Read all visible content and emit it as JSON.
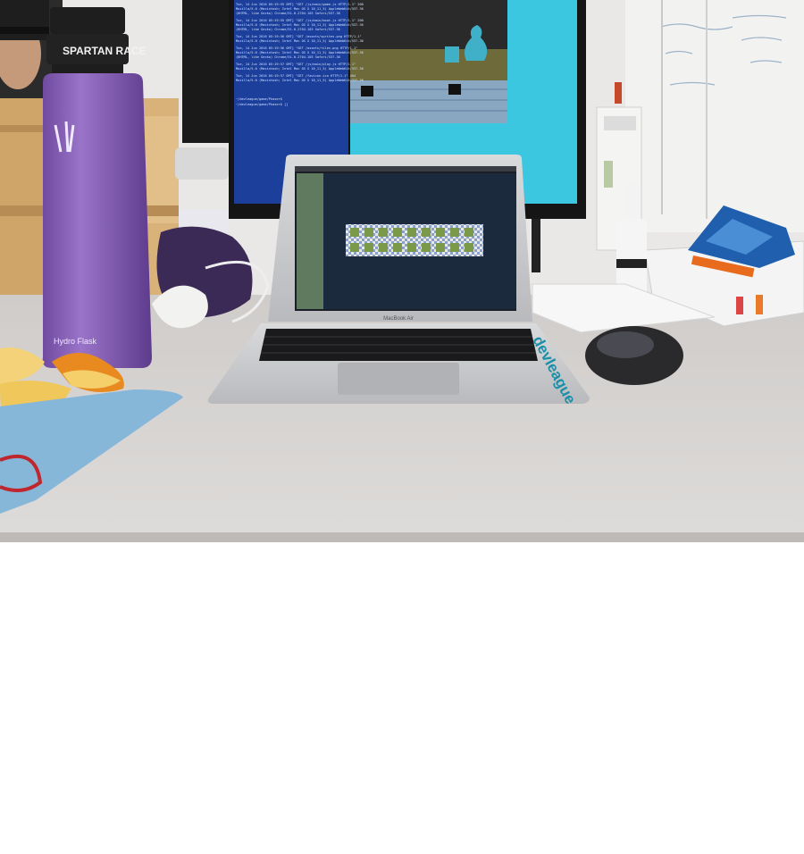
{
  "photo": {
    "bottle_brand_band": "SPARTAN RACE",
    "bottle_maker": "Hydro Flask",
    "laptop_model": "MacBook Air",
    "laptop_sticker": "devleague",
    "terminal_lines": [
      "Tue, 14 Jun 2016 05:19:55 GMT] \"GET /js/main/game.js HTTP/1.1\" 200",
      "Mozilla/5.0 (Macintosh; Intel Mac OS X 10_11_5) AppleWebKit/537.36",
      "(KHTML, like Gecko) Chrome/51.0.2704.103 Safari/537.36",
      "Tue, 14 Jun 2016 05:19:55 GMT] \"GET /js/main/boot.js HTTP/1.1\" 200",
      "Mozilla/5.0 (Macintosh; Intel Mac OS X 10_11_5) AppleWebKit/537.36",
      "(KHTML, like Gecko) Chrome/51.0.2704.103 Safari/537.36",
      "Tue, 14 Jun 2016 05:19:56 GMT] \"GET /assets/sprites.png HTTP/1.1\"",
      "Mozilla/5.0 (Macintosh; Intel Mac OS X 10_11_5) AppleWebKit/537.36",
      "Tue, 14 Jun 2016 05:19:56 GMT] \"GET /assets/tiles.png HTTP/1.1\"",
      "Mozilla/5.0 (Macintosh; Intel Mac OS X 10_11_5) AppleWebKit/537.36",
      "(KHTML, like Gecko) Chrome/51.0.2704.103 Safari/537.36",
      "Tue, 14 Jun 2016 05:19:57 GMT] \"GET /js/main/play.js HTTP/1.1\"",
      "Mozilla/5.0 (Macintosh; Intel Mac OS X 10_11_5) AppleWebKit/537.36",
      "Tue, 14 Jun 2016 05:19:57 GMT] \"GET /favicon.ico HTTP/1.1\" 404",
      "Mozilla/5.0 (Macintosh; Intel Mac OS X 10_11_5) AppleWebKit/537.36"
    ],
    "terminal_prompt_lines": [
      "~/devleague/game/Phaser$",
      "~/devleague/game/Phaser$ []"
    ],
    "colors": {
      "desk": "#d6d3d1",
      "monitor_screen": "#3bc7df",
      "terminal_bg": "#1e3a8a",
      "bottle": "#8a62b8",
      "laptop_body": "#c9cacd",
      "sticker": "#1a8fa8"
    }
  }
}
